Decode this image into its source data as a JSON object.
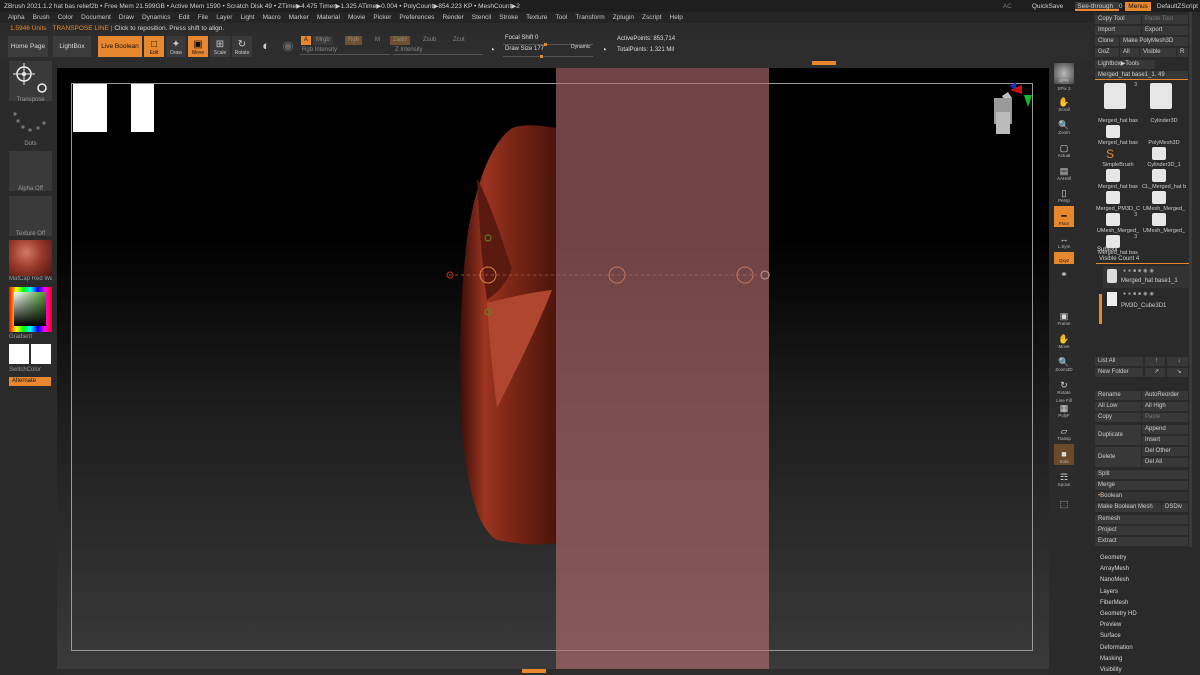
{
  "titlebar": {
    "title": "ZBrush 2021.1.2   hat bas relief2b   • Free Mem 21.599GB • Active Mem 1590 • Scratch Disk 49 • ZTime▶4.475 Timer▶1.325 ATime▶0.004 • PolyCount▶854.223 KP • MeshCount▶2",
    "ac": "AC",
    "quicksave": "QuickSave",
    "see_through_label": "See-through",
    "see_through_value": "0",
    "menus": "Menus",
    "script": "DefaultZScript"
  },
  "menubar": [
    "Alpha",
    "Brush",
    "Color",
    "Document",
    "Draw",
    "Dynamics",
    "Edit",
    "File",
    "Layer",
    "Light",
    "Macro",
    "Marker",
    "Material",
    "Movie",
    "Picker",
    "Preferences",
    "Render",
    "Stencil",
    "Stroke",
    "Texture",
    "Tool",
    "Transform",
    "Zplugin",
    "Zscript",
    "Help"
  ],
  "infoline": {
    "units": "1.5946 Units",
    "mode": "TRANSPOSE LINE |",
    "hint": "Click to reposition. Press shift to align."
  },
  "shelf": {
    "home_page": "Home Page",
    "lightbox": "LightBox",
    "live_boolean": "Live Boolean",
    "edit": "Edit",
    "draw": "Draw",
    "move": "Move",
    "scale": "Scale",
    "rotate": "Rotate",
    "a": "A",
    "mrgb": "Mrgb",
    "rgb": "Rgb",
    "m": "M",
    "zadd": "Zadd",
    "zsub": "Zsub",
    "zcut": "Zcut",
    "rgb_intensity": "Rgb Intensity",
    "z_intensity": "Z Intensity",
    "focal_shift": "Focal Shift 0",
    "draw_size": "Draw Size 177",
    "dynamic": "Dynamic",
    "active_points": "ActivePoints: 853,714",
    "total_points": "TotalPoints: 1.321 Mil"
  },
  "lefttray": {
    "transpose": "Transpose",
    "dots": "Dots",
    "alpha_off": "Alpha Off",
    "texture_off": "Texture Off",
    "material": "MatCap Red Wax",
    "gradient": "Gradient",
    "switchcolor": "SwitchColor",
    "alternate": "Alternate"
  },
  "nav": [
    "BPR",
    "SPix 3",
    "Scroll",
    "Zoom",
    "Actual",
    "AAHalf",
    "Persp",
    "Floor",
    "L.Sym",
    "Qxyz",
    "Frame",
    "Move",
    "Zoom3D",
    "Rotate",
    "Line Fill",
    "PolyF",
    "Transp",
    "Solo",
    "Xpose"
  ],
  "toolpanel": {
    "copy_tool": "Copy Tool",
    "paste_tool": "Paste Tool",
    "import": "Import",
    "export": "Export",
    "clone": "Clone",
    "make_polymesh": "Make PolyMesh3D",
    "goz": "GoZ",
    "all": "All",
    "visible": "Visible",
    "r": "R",
    "lightbox_tools": "Lightbox▶Tools",
    "current_tool": "Merged_hat base1_1. 49",
    "thumbs": [
      {
        "cap": "Merged_hat bas",
        "num": "3"
      },
      {
        "cap": "Cylinder3D",
        "num": ""
      },
      {
        "cap": "Merged_hat bas",
        "num": ""
      },
      {
        "cap": "PolyMesh3D",
        "num": ""
      },
      {
        "cap": "SimpleBrush",
        "num": ""
      },
      {
        "cap": "Cylinder3D_1",
        "num": ""
      },
      {
        "cap": "Merged_hat bas",
        "num": ""
      },
      {
        "cap": "CL_Merged_hat b",
        "num": ""
      },
      {
        "cap": "Merged_PM3D_C",
        "num": ""
      },
      {
        "cap": "UMesh_Merged_",
        "num": ""
      },
      {
        "cap": "UMesh_Merged_",
        "num": "3"
      },
      {
        "cap": "UMesh_Merged_",
        "num": ""
      },
      {
        "cap": "Merged_hat bas",
        "num": "3"
      }
    ],
    "subtool": "Subtool",
    "visible_count": "Visible Count 4",
    "subtool_items": [
      "Merged_hat base1_1",
      "PM3D_Cube3D1"
    ],
    "list_all": "List All",
    "new_folder": "New Folder",
    "rename": "Rename",
    "autoreorder": "AutoReorder",
    "all_low": "All Low",
    "all_high": "All High",
    "copy": "Copy",
    "paste": "Paste",
    "duplicate": "Duplicate",
    "append": "Append",
    "insert": "Insert",
    "delete": "Delete",
    "del_other": "Del Other",
    "del_all": "Del All",
    "split": "Split",
    "merge": "Merge",
    "boolean": "Boolean",
    "make_boolean_mesh": "Make Boolean Mesh",
    "dsdiv": "DSDiv",
    "remesh": "Remesh",
    "project": "Project",
    "extract": "Extract",
    "menus": [
      "Geometry",
      "ArrayMesh",
      "NanoMesh",
      "Layers",
      "FiberMesh",
      "Geometry HD",
      "Preview",
      "Surface",
      "Deformation",
      "Masking",
      "Visibility"
    ]
  },
  "colors": {
    "accent": "#e8882e",
    "model": "#8a2a1c",
    "overlay": "#7a4e4e"
  }
}
